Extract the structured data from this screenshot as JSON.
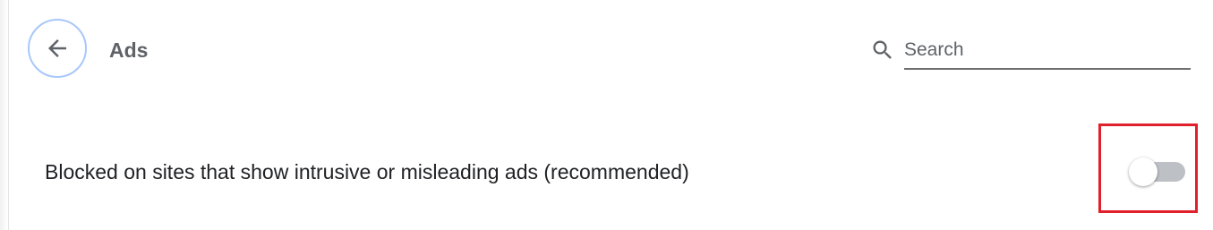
{
  "header": {
    "title": "Ads",
    "back_icon": "arrow-left-icon"
  },
  "search": {
    "placeholder": "Search",
    "value": "",
    "icon": "search-icon"
  },
  "setting": {
    "label": "Blocked on sites that show intrusive or misleading ads (recommended)",
    "toggle_state": "off"
  },
  "colors": {
    "back_button_ring": "#a8c7fa",
    "highlight_box": "#e0202b",
    "toggle_track_off": "#bdc1c6"
  }
}
